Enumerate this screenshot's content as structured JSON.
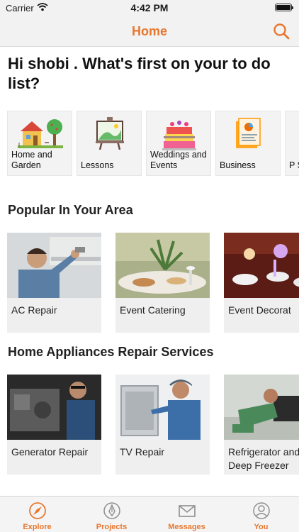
{
  "status_bar": {
    "carrier": "Carrier",
    "time": "4:42 PM"
  },
  "nav": {
    "title": "Home"
  },
  "greeting": "Hi shobi . What's first on your to do list?",
  "categories": [
    {
      "label": "Home and Garden",
      "icon": "house-garden-icon"
    },
    {
      "label": "Lessons",
      "icon": "easel-icon"
    },
    {
      "label": "Weddings and Events",
      "icon": "cake-icon"
    },
    {
      "label": "Business",
      "icon": "documents-chart-icon"
    },
    {
      "label": "P S",
      "icon": "partial-icon"
    }
  ],
  "sections": [
    {
      "title": "Popular In Your Area",
      "items": [
        "AC Repair",
        "Event Catering",
        "Event Decorat"
      ]
    },
    {
      "title": "Home Appliances Repair Services",
      "items": [
        "Generator Repair",
        "TV Repair",
        "Refrigerator and Deep Freezer Repair"
      ]
    }
  ],
  "tabs": [
    {
      "label": "Explore",
      "icon": "compass-icon"
    },
    {
      "label": "Projects",
      "icon": "pen-nib-icon"
    },
    {
      "label": "Messages",
      "icon": "envelope-icon"
    },
    {
      "label": "You",
      "icon": "person-icon"
    }
  ],
  "colors": {
    "accent": "#e8772e",
    "card_bg": "#efefef"
  }
}
